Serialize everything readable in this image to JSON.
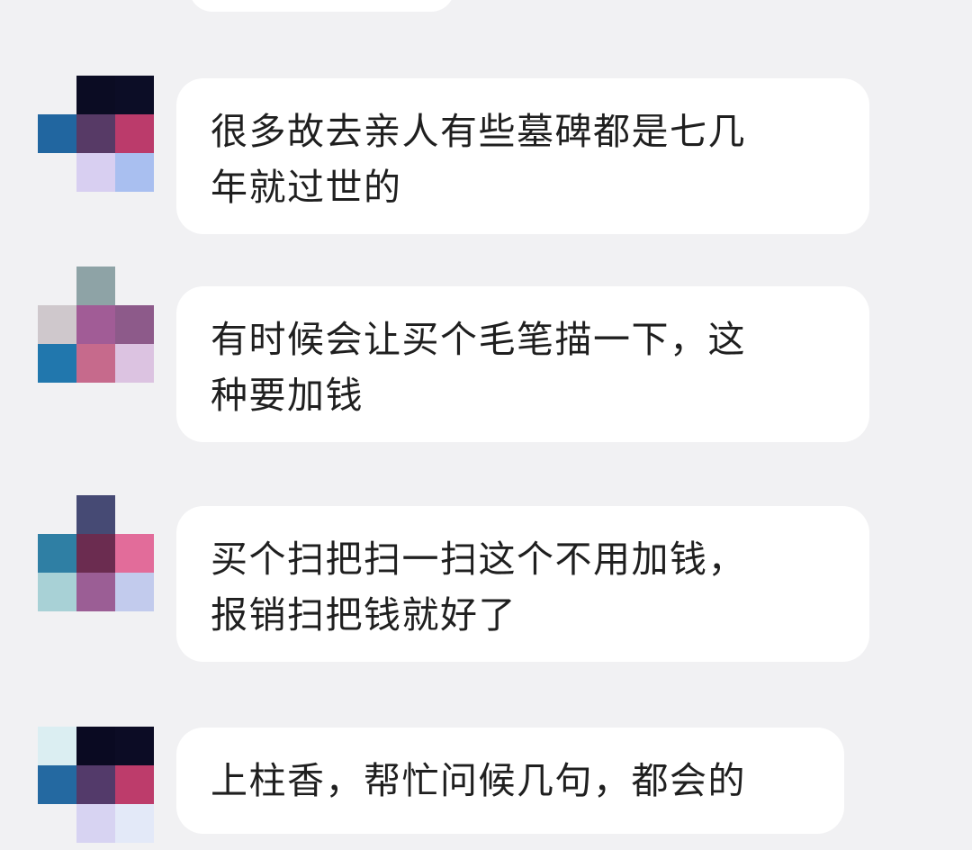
{
  "messages": [
    {
      "text": "很多故去亲人有些墓碑都是七几\n年就过世的",
      "avatar_colors": [
        "#f1f1f3",
        "#0b0c23",
        "#0c0d26",
        "#2166a0",
        "#573a66",
        "#bb3b6b",
        "#f1f1f3",
        "#d8cff1",
        "#a9bff0"
      ]
    },
    {
      "text": "有时候会让买个毛笔描一下，这\n种要加钱",
      "avatar_colors": [
        "#f1f1f3",
        "#8ea3a6",
        "#f1f1f3",
        "#cfc8cc",
        "#a15c96",
        "#8d5a8a",
        "#2177ad",
        "#c66a8c",
        "#dcc3e1"
      ]
    },
    {
      "text": "买个扫把扫一扫这个不用加钱，\n报销扫把钱就好了",
      "avatar_colors": [
        "#f1f1f3",
        "#464a74",
        "#f1f1f3",
        "#2f7fa4",
        "#6b2c50",
        "#e26c9a",
        "#a8d1d6",
        "#9b5e95",
        "#c2cbed"
      ]
    },
    {
      "text": "上柱香，帮忙问候几句，都会的",
      "avatar_colors": [
        "#dbeef2",
        "#0a0a22",
        "#0c0c25",
        "#2469a1",
        "#533a6a",
        "#bd3c6b",
        "#f1f1f3",
        "#d7d3f2",
        "#e3e9f8"
      ]
    }
  ]
}
